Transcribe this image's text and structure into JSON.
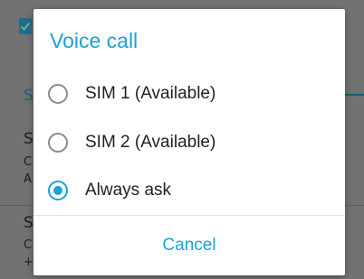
{
  "dialog": {
    "title": "Voice call",
    "options": [
      {
        "label": "SIM 1 (Available)",
        "selected": false
      },
      {
        "label": "SIM 2 (Available)",
        "selected": false
      },
      {
        "label": "Always ask",
        "selected": true
      }
    ],
    "cancel_label": "Cancel"
  },
  "background": {
    "partial_texts": [
      "S",
      "S",
      "C",
      "A",
      "S",
      "C",
      "+"
    ]
  },
  "colors": {
    "accent": "#1aa2d8",
    "scrim": "#727272",
    "dialog_bg": "#ffffff"
  }
}
